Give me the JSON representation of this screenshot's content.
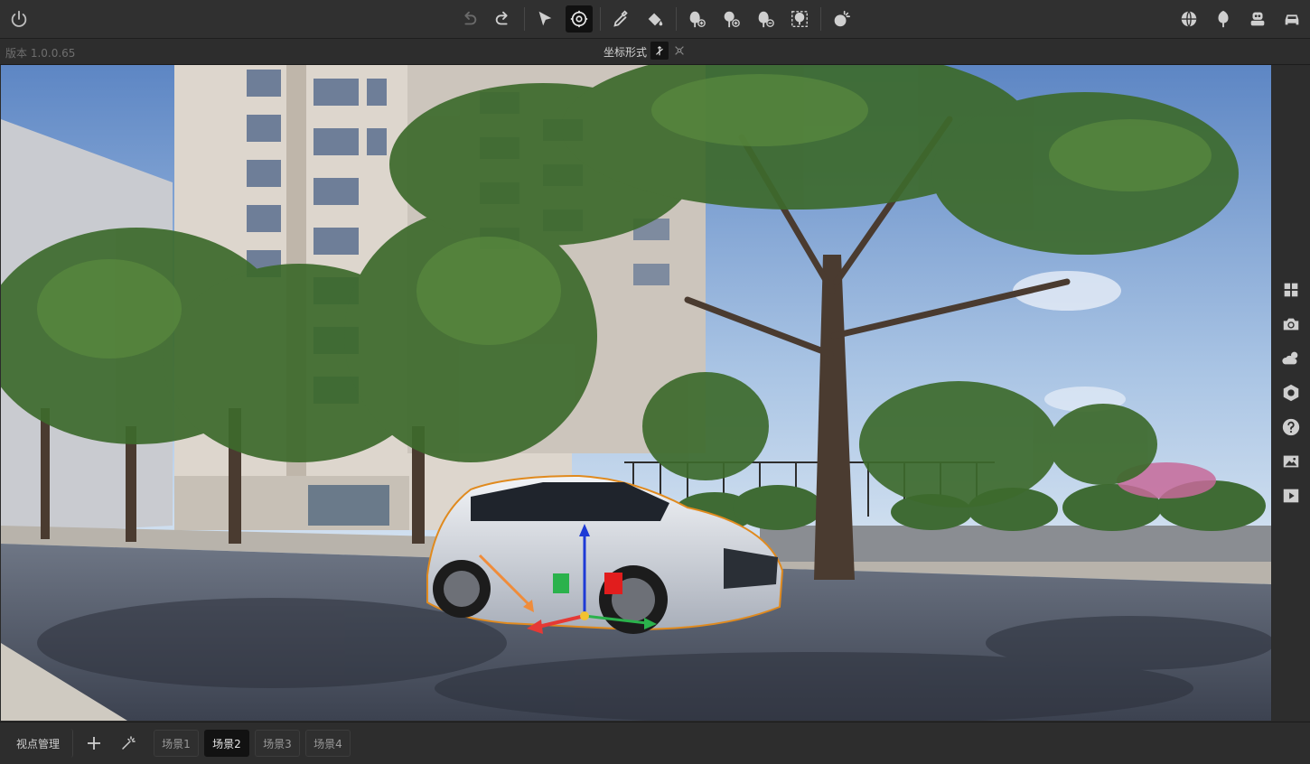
{
  "toolbar": {
    "power": "power-icon",
    "undo": "undo-icon",
    "redo": "redo-icon",
    "select": "select-arrow-icon",
    "orbit": "orbit-icon",
    "eyedropper": "eyedropper-icon",
    "paint": "paint-bucket-icon",
    "plant_add": "plant-add-icon",
    "plant_add_alt": "plant-add-alt-icon",
    "plant_remove": "plant-remove-icon",
    "plant_scatter": "plant-scatter-icon",
    "weather": "weather-icon",
    "right": [
      "globe-icon",
      "tree-icon",
      "robot-icon",
      "car-icon"
    ]
  },
  "subbar": {
    "version": "版本 1.0.0.65",
    "coord_label": "坐标形式"
  },
  "rightbar": [
    "grid-icon",
    "camera-icon",
    "cloud-sun-icon",
    "settings-icon",
    "help-icon",
    "image-icon",
    "play-icon"
  ],
  "bottombar": {
    "viewpoint_manage": "视点管理",
    "tabs": [
      "场景1",
      "场景2",
      "场景3",
      "场景4"
    ],
    "active_tab": 1
  },
  "colors": {
    "accent_active": "#111111",
    "selection_outline": "#e08a1e",
    "axis_x": "#e53935",
    "axis_y": "#2bb24c",
    "axis_z": "#1e3ad6"
  }
}
